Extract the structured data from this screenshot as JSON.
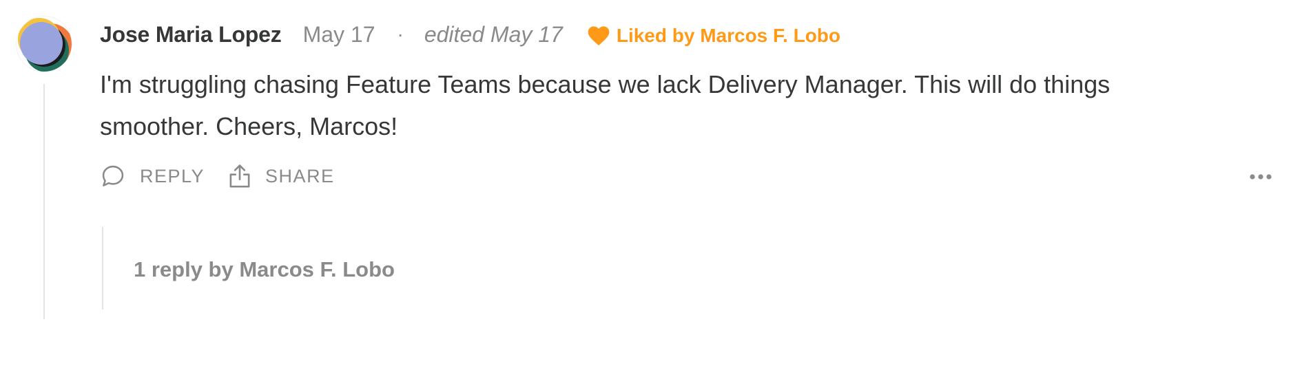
{
  "comment": {
    "author": "Jose Maria Lopez",
    "date": "May 17",
    "separator": "·",
    "edited": "edited May 17",
    "liked_by": "Liked by Marcos F. Lobo",
    "body": "I'm struggling chasing Feature Teams because we lack Delivery Manager. This will do things smoother. Cheers, Marcos!",
    "actions": {
      "reply_label": "REPLY",
      "share_label": "SHARE"
    },
    "replies_link": "1 reply by Marcos F. Lobo"
  },
  "icons": {
    "avatar": "avatar-image",
    "like": "heart-icon",
    "reply": "comment-bubble-icon",
    "share": "share-upload-icon",
    "more": "more-dots-icon"
  },
  "colors": {
    "liked": "#ff9a18",
    "muted": "#8a8a8a",
    "text": "#363737",
    "thread_line": "#e4e4e4"
  }
}
